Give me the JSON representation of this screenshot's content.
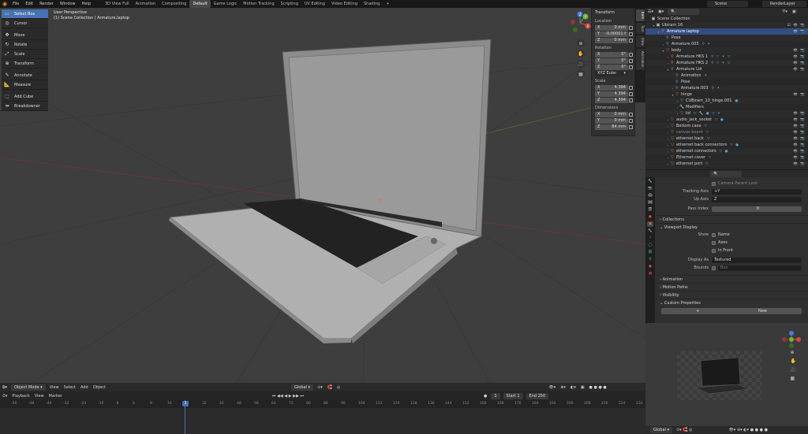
{
  "topbar": {
    "menus": [
      "File",
      "Edit",
      "Render",
      "Window",
      "Help"
    ],
    "tabs": [
      "3D View Full",
      "Animation",
      "Compositing",
      "Default",
      "Game Logic",
      "Motion Tracking",
      "Scripting",
      "UV Editing",
      "Video Editing",
      "Shading"
    ],
    "active_tab": "Default",
    "add": "+",
    "scene": "Scene",
    "view_layer": "RenderLayer"
  },
  "toolbar": [
    {
      "label": "Select Box",
      "icon": "select-box-icon",
      "glyph": "▭"
    },
    {
      "label": "Cursor",
      "icon": "cursor-icon",
      "glyph": "◎"
    },
    {
      "label": "Move",
      "icon": "move-icon",
      "glyph": "✥"
    },
    {
      "label": "Rotate",
      "icon": "rotate-icon",
      "glyph": "↻"
    },
    {
      "label": "Scale",
      "icon": "scale-icon",
      "glyph": "⤢"
    },
    {
      "label": "Transform",
      "icon": "transform-icon",
      "glyph": "⊕"
    },
    {
      "label": "Annotate",
      "icon": "annotate-icon",
      "glyph": "✎"
    },
    {
      "label": "Measure",
      "icon": "measure-icon",
      "glyph": "📐"
    },
    {
      "label": "Add Cube",
      "icon": "add-cube-icon",
      "glyph": "⬚"
    },
    {
      "label": "Breakdowner",
      "icon": "breakdowner-icon",
      "glyph": "⇹"
    }
  ],
  "viewport": {
    "title": "User Perspective",
    "subtitle": "(1) Scene Collection | Armature.laptop",
    "gizmo": {
      "x": "X",
      "y": "Y",
      "z": "Z"
    }
  },
  "npanel": {
    "header": "Transform",
    "location_label": "Location",
    "location": [
      [
        "X",
        "0 mm"
      ],
      [
        "Y",
        "-0.00001 f"
      ],
      [
        "Z",
        "0 mm"
      ]
    ],
    "rotation_label": "Rotation",
    "rotation": [
      [
        "X",
        "0°"
      ],
      [
        "Y",
        "0°"
      ],
      [
        "Z",
        "0°"
      ]
    ],
    "rotation_mode": "XYZ Euler",
    "scale_label": "Scale",
    "scale": [
      [
        "X",
        "4.394"
      ],
      [
        "Y",
        "4.394"
      ],
      [
        "Z",
        "4.394"
      ]
    ],
    "dimensions_label": "Dimensions",
    "dimensions": [
      [
        "X",
        "0 mm"
      ],
      [
        "Y",
        "0 mm"
      ],
      [
        "Z",
        "84 mm"
      ]
    ],
    "tabs": [
      "Item",
      "Tool",
      "View",
      "Animation"
    ]
  },
  "vp_header": {
    "mode": "Object Mode",
    "menus": [
      "View",
      "Select",
      "Add",
      "Object"
    ],
    "orientation": "Global"
  },
  "timeline": {
    "menus": [
      "Playback",
      "View",
      "Marker"
    ],
    "current": "1",
    "start_label": "Start",
    "start": "1",
    "end_label": "End",
    "end": "250",
    "ticks": [
      "-56",
      "-48",
      "-40",
      "-32",
      "-24",
      "-16",
      "-8",
      "0",
      "8",
      "16",
      "24",
      "32",
      "40",
      "48",
      "56",
      "64",
      "72",
      "80",
      "88",
      "96",
      "104",
      "112",
      "120",
      "128",
      "136",
      "144",
      "152",
      "160",
      "168",
      "176",
      "184",
      "192",
      "200",
      "208",
      "216",
      "224",
      "232"
    ],
    "playhead": "1"
  },
  "outliner": {
    "search_placeholder": "",
    "rows": [
      {
        "indent": 0,
        "icon": "scene-collection-icon",
        "glyph": "▣",
        "color": "#cccccc",
        "label": "Scene Collection",
        "tw": "",
        "extras": "",
        "vis": "",
        "dim": false,
        "sel": false
      },
      {
        "indent": 1,
        "icon": "collection-icon",
        "glyph": "▣",
        "color": "#cccccc",
        "label": "Ubiram 16",
        "tw": "▾",
        "extras": "",
        "vis": "☑ 👁 📷",
        "dim": false,
        "sel": false
      },
      {
        "indent": 2,
        "icon": "armature-icon",
        "glyph": "⚲",
        "color": "#e07a3b",
        "label": "Armature.laptop",
        "tw": "▾",
        "extras": "",
        "vis": "👁 📷",
        "dim": false,
        "sel": true
      },
      {
        "indent": 3,
        "icon": "pose-icon",
        "glyph": "⚲",
        "color": "#5aa0c8",
        "label": "Pose",
        "tw": "",
        "extras": "",
        "vis": "",
        "dim": false,
        "sel": false
      },
      {
        "indent": 3,
        "icon": "armature-data-icon",
        "glyph": "⚲",
        "color": "#5aa0c8",
        "label": "Armature.003",
        "tw": "›",
        "extras": "⚲ ✦",
        "vis": "",
        "dim": false,
        "sel": false
      },
      {
        "indent": 3,
        "icon": "mesh-icon",
        "glyph": "▽",
        "color": "#e07a3b",
        "label": "body",
        "tw": "▾",
        "extras": "",
        "vis": "👁 📷",
        "dim": false,
        "sel": false
      },
      {
        "indent": 4,
        "icon": "armature-icon",
        "glyph": "⚲",
        "color": "#e07a3b",
        "label": "Armature HKS 1",
        "tw": "›",
        "extras": "⚲ ▽ ✦ ▽",
        "vis": "👁 📷",
        "dim": false,
        "sel": false
      },
      {
        "indent": 4,
        "icon": "armature-icon",
        "glyph": "⚲",
        "color": "#e07a3b",
        "label": "Armature HKS 2",
        "tw": "›",
        "extras": "⚲ ▽ ✦ ▽",
        "vis": "👁 📷",
        "dim": false,
        "sel": false
      },
      {
        "indent": 4,
        "icon": "armature-icon",
        "glyph": "⚲",
        "color": "#e07a3b",
        "label": "Armature Lid",
        "tw": "▾",
        "extras": "",
        "vis": "👁 📷",
        "dim": false,
        "sel": false
      },
      {
        "indent": 5,
        "icon": "animation-icon",
        "glyph": "⚲",
        "color": "#5aa0c8",
        "label": "Animation",
        "tw": "",
        "extras": "✦",
        "vis": "",
        "dim": false,
        "sel": false
      },
      {
        "indent": 5,
        "icon": "pose-icon",
        "glyph": "⚲",
        "color": "#5aa0c8",
        "label": "Pose",
        "tw": "",
        "extras": "",
        "vis": "",
        "dim": false,
        "sel": false
      },
      {
        "indent": 5,
        "icon": "armature-data-icon",
        "glyph": "⚲",
        "color": "#5aa0c8",
        "label": "Armature.003",
        "tw": "›",
        "extras": "⚲ ✦",
        "vis": "",
        "dim": false,
        "sel": false
      },
      {
        "indent": 5,
        "icon": "mesh-icon",
        "glyph": "▽",
        "color": "#e07a3b",
        "label": "hinge",
        "tw": "▾",
        "extras": "",
        "vis": "👁 📷",
        "dim": false,
        "sel": false
      },
      {
        "indent": 6,
        "icon": "mesh-data-icon",
        "glyph": "▽",
        "color": "#5ac86a",
        "label": "CUBiram_13_hinge.001",
        "tw": "›",
        "extras": "●",
        "vis": "",
        "dim": false,
        "sel": false
      },
      {
        "indent": 6,
        "icon": "modifiers-icon",
        "glyph": "🔧",
        "color": "#5aa0c8",
        "label": "Modifiers",
        "tw": "›",
        "extras": "",
        "vis": "",
        "dim": false,
        "sel": false
      },
      {
        "indent": 6,
        "icon": "mesh-icon",
        "glyph": "▽",
        "color": "#e07a3b",
        "label": "lid",
        "tw": "›",
        "extras": "▽ 🔧 ● ▽ ✦",
        "vis": "👁 📷",
        "dim": false,
        "sel": false
      },
      {
        "indent": 4,
        "icon": "mesh-icon",
        "glyph": "▽",
        "color": "#e07a3b",
        "label": "audio_jack_socket",
        "tw": "›",
        "extras": "▽ ●",
        "vis": "👁 📷",
        "dim": false,
        "sel": false
      },
      {
        "indent": 4,
        "icon": "mesh-icon",
        "glyph": "▽",
        "color": "#e07a3b",
        "label": "Bottom case",
        "tw": "›",
        "extras": "▽",
        "vis": "👁 📷",
        "dim": false,
        "sel": false
      },
      {
        "indent": 4,
        "icon": "mesh-icon",
        "glyph": "▽",
        "color": "#e07a3b",
        "label": "canvas board",
        "tw": "›",
        "extras": "▽",
        "vis": "👁 📷",
        "dim": true,
        "sel": false
      },
      {
        "indent": 4,
        "icon": "mesh-icon",
        "glyph": "▽",
        "color": "#e07a3b",
        "label": "ethernet back",
        "tw": "›",
        "extras": "▽",
        "vis": "👁 📷",
        "dim": false,
        "sel": false
      },
      {
        "indent": 4,
        "icon": "mesh-icon",
        "glyph": "▽",
        "color": "#e07a3b",
        "label": "ethernet back connectors",
        "tw": "›",
        "extras": "▽ ●",
        "vis": "👁 📷",
        "dim": false,
        "sel": false
      },
      {
        "indent": 4,
        "icon": "mesh-icon",
        "glyph": "▽",
        "color": "#e07a3b",
        "label": "ethernet connectors",
        "tw": "›",
        "extras": "▽ ●",
        "vis": "👁 📷",
        "dim": false,
        "sel": false
      },
      {
        "indent": 4,
        "icon": "mesh-icon",
        "glyph": "▽",
        "color": "#e07a3b",
        "label": "Ethernet cover",
        "tw": "›",
        "extras": "▽",
        "vis": "👁 📷",
        "dim": false,
        "sel": false
      },
      {
        "indent": 4,
        "icon": "mesh-icon",
        "glyph": "▽",
        "color": "#e07a3b",
        "label": "ethernet port",
        "tw": "›",
        "extras": "▽",
        "vis": "👁 📷",
        "dim": false,
        "sel": false
      }
    ]
  },
  "properties": {
    "top_check": "Camera Parent Lock",
    "tracking_axis_label": "Tracking Axis",
    "tracking_axis": "+Y",
    "up_axis_label": "Up Axis",
    "up_axis": "Z",
    "pass_index_label": "Pass Index",
    "pass_index": "0",
    "sections": {
      "collections": "Collections",
      "viewport_display": "Viewport Display",
      "animation": "Animation",
      "motion_paths": "Motion Paths",
      "visibility": "Visibility",
      "custom_properties": "Custom Properties"
    },
    "show_label": "Show",
    "show_opts": [
      "Name",
      "Axes",
      "In Front"
    ],
    "display_as_label": "Display As",
    "display_as": "Textured",
    "bounds_label": "Bounds",
    "bounds": "Box",
    "new_label": "New"
  },
  "preview_footer": {
    "orientation": "Global"
  }
}
